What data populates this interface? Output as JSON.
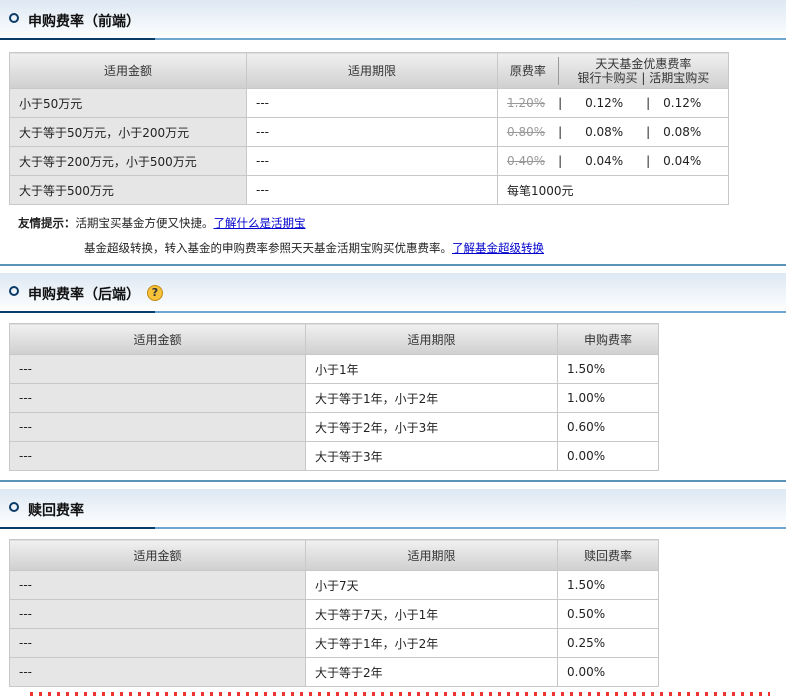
{
  "front": {
    "title": "申购费率（前端）",
    "headers": {
      "amount": "适用金额",
      "period": "适用期限",
      "orig": "原费率",
      "discount": "天天基金优惠费率",
      "card": "银行卡购买",
      "hqb": "活期宝购买"
    },
    "rows": [
      {
        "amount": "小于50万元",
        "period": "---",
        "orig": "1.20%",
        "card": "0.12%",
        "hqb": "0.12%"
      },
      {
        "amount": "大于等于50万元，小于200万元",
        "period": "---",
        "orig": "0.80%",
        "card": "0.08%",
        "hqb": "0.08%"
      },
      {
        "amount": "大于等于200万元，小于500万元",
        "period": "---",
        "orig": "0.40%",
        "card": "0.04%",
        "hqb": "0.04%"
      },
      {
        "amount": "大于等于500万元",
        "period": "---",
        "fixed": "每笔1000元"
      }
    ],
    "sep": "|"
  },
  "tips": {
    "label": "友情提示：",
    "line1": "活期宝买基金方便又快捷。",
    "link1": "了解什么是活期宝",
    "line2": "基金超级转换，转入基金的申购费率参照天天基金活期宝购买优惠费率。",
    "link2": "了解基金超级转换"
  },
  "back": {
    "title": "申购费率（后端）",
    "help": "?",
    "headers": [
      "适用金额",
      "适用期限",
      "申购费率"
    ],
    "rows": [
      [
        "---",
        "小于1年",
        "1.50%"
      ],
      [
        "---",
        "大于等于1年，小于2年",
        "1.00%"
      ],
      [
        "---",
        "大于等于2年，小于3年",
        "0.60%"
      ],
      [
        "---",
        "大于等于3年",
        "0.00%"
      ]
    ]
  },
  "redeem": {
    "title": "赎回费率",
    "headers": [
      "适用金额",
      "适用期限",
      "赎回费率"
    ],
    "rows": [
      [
        "---",
        "小于7天",
        "1.50%"
      ],
      [
        "---",
        "大于等于7天，小于1年",
        "0.50%"
      ],
      [
        "---",
        "大于等于1年，小于2年",
        "0.25%"
      ],
      [
        "---",
        "大于等于2年",
        "0.00%"
      ]
    ]
  }
}
